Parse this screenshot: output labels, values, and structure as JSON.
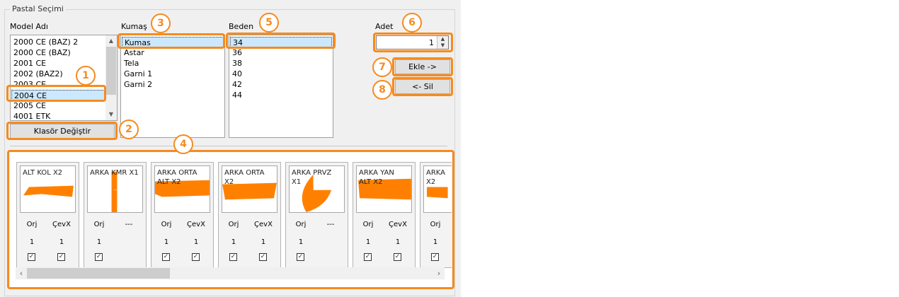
{
  "group_title": "Pastal Seçimi",
  "model": {
    "label": "Model Adı",
    "items": [
      "2000 CE (BAZ) 2",
      "2000 CE (BAZ)",
      "2001 CE",
      "2002 (BAZ2)",
      "2003 CE",
      "2004 CE",
      "2005 CE",
      "4001 ETK"
    ],
    "selected": "2004 CE"
  },
  "folder_button": "Klasör Değiştir",
  "fabric": {
    "label": "Kumaş",
    "items": [
      "Kumas",
      "Astar",
      "Tela",
      "Garni 1",
      "Garni 2"
    ],
    "selected": "Kumas"
  },
  "size": {
    "label": "Beden",
    "items": [
      "34",
      "36",
      "38",
      "40",
      "42",
      "44"
    ],
    "selected": "34"
  },
  "quantity": {
    "label": "Adet",
    "value": "1"
  },
  "add_button": "Ekle ->",
  "remove_button": "<- Sil",
  "badges": [
    "1",
    "2",
    "3",
    "4",
    "5",
    "6",
    "7",
    "8"
  ],
  "pieces": [
    {
      "name": "ALT KOL X2",
      "col1": "Orj",
      "col2": "ÇevX",
      "val1": "1",
      "val2": "1",
      "two_checks": true
    },
    {
      "name": "ARKA KMR X1",
      "col1": "Orj",
      "col2": "---",
      "val1": "1",
      "val2": "",
      "two_checks": false
    },
    {
      "name": "ARKA ORTA\nALT X2",
      "col1": "Orj",
      "col2": "ÇevX",
      "val1": "1",
      "val2": "1",
      "two_checks": true
    },
    {
      "name": "ARKA ORTA\nX2",
      "col1": "Orj",
      "col2": "ÇevX",
      "val1": "1",
      "val2": "1",
      "two_checks": true
    },
    {
      "name": "ARKA PRVZ\nX1",
      "col1": "Orj",
      "col2": "---",
      "val1": "1",
      "val2": "",
      "two_checks": false
    },
    {
      "name": "ARKA YAN\nALT X2",
      "col1": "Orj",
      "col2": "ÇevX",
      "val1": "1",
      "val2": "1",
      "two_checks": true
    },
    {
      "name": "ARKA\nX2",
      "col1": "Orj",
      "col2": "",
      "val1": "1",
      "val2": "",
      "two_checks": false
    }
  ],
  "colors": {
    "highlight": "#f58b1f",
    "piece_fill": "#ff8000",
    "selection": "#cce8ff"
  }
}
